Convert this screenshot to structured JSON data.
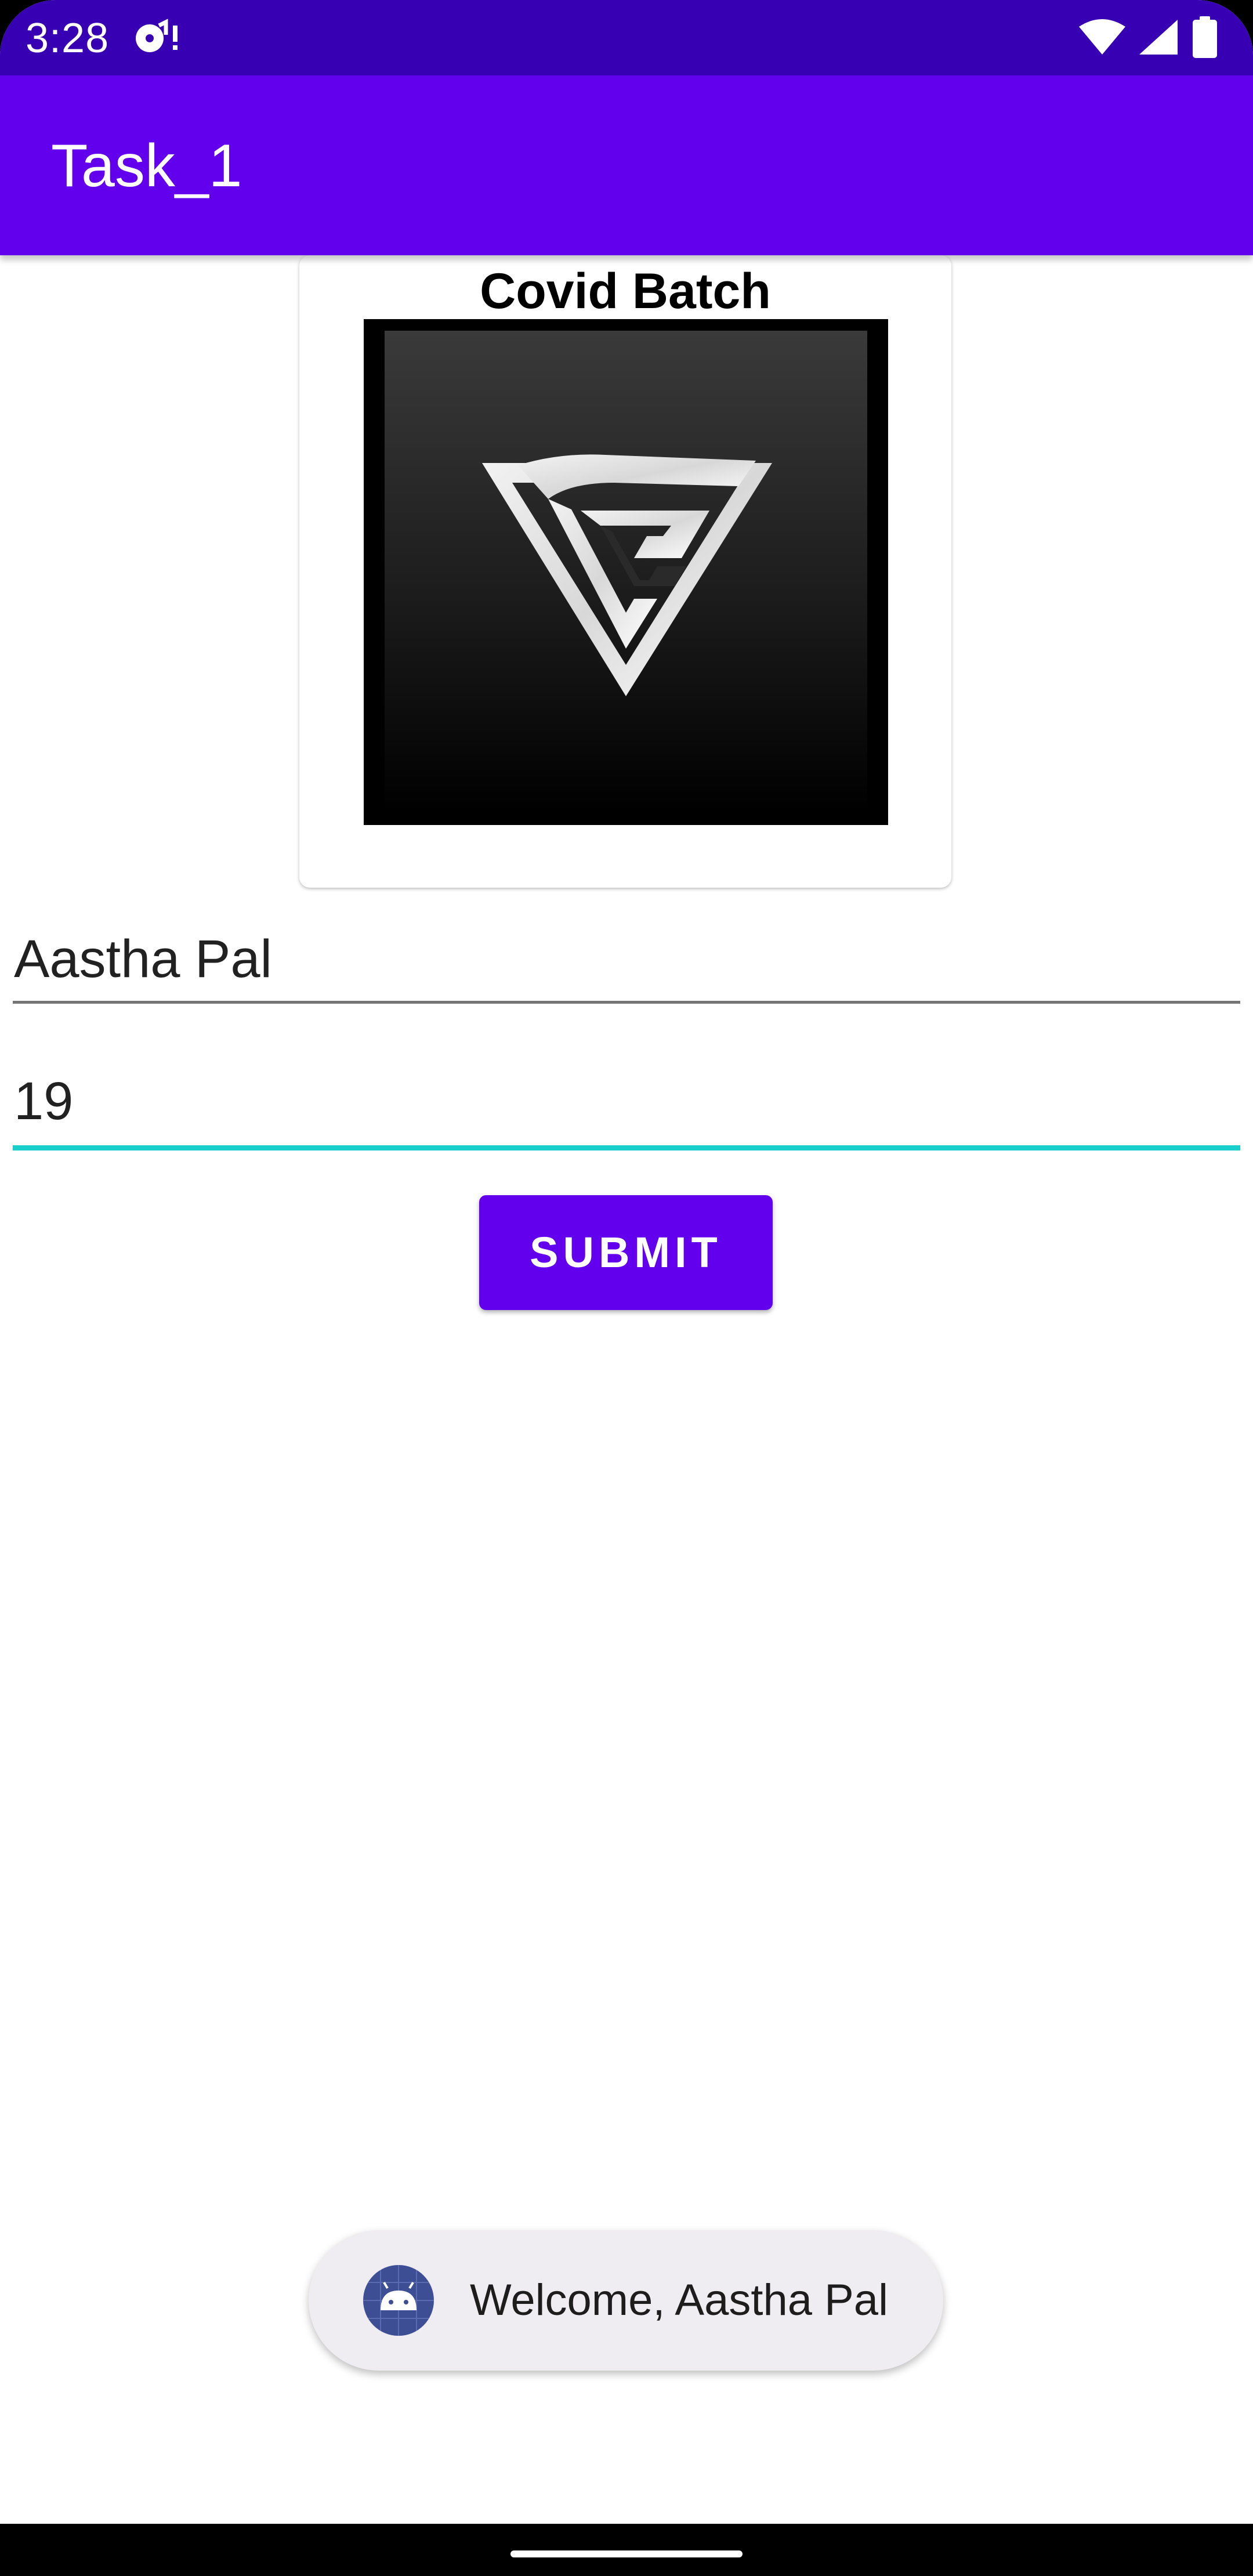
{
  "status_bar": {
    "time": "3:28",
    "icons": [
      "notification-disc-icon",
      "wifi-icon",
      "cellular-signal-icon",
      "battery-icon"
    ]
  },
  "app_bar": {
    "title": "Task_1"
  },
  "card": {
    "title": "Covid Batch",
    "image_icon": "cg-triangle-logo-icon"
  },
  "form": {
    "name_value": "Aastha Pal",
    "age_value": "19",
    "submit_label": "SUBMIT"
  },
  "toast": {
    "message": "Welcome, Aastha Pal",
    "icon": "android-icon"
  },
  "colors": {
    "status_bar": "#3700B3",
    "primary": "#6200EE",
    "focused_underline": "#18CFCB",
    "toast_background": "#EFEDF2"
  }
}
